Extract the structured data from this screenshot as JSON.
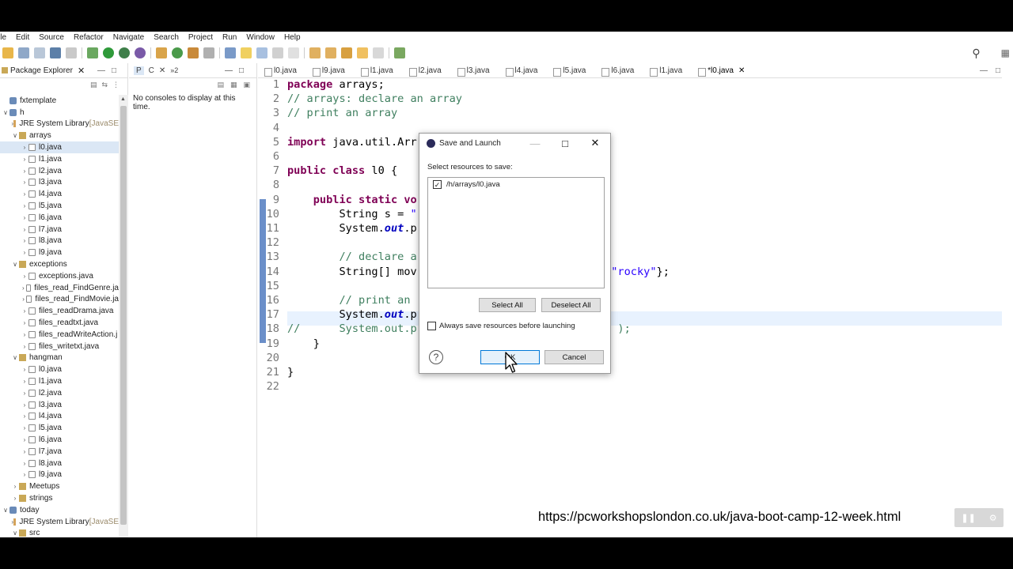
{
  "menu": [
    "ile",
    "Edit",
    "Source",
    "Refactor",
    "Navigate",
    "Search",
    "Project",
    "Run",
    "Window",
    "Help"
  ],
  "left_panel": {
    "tab_label": "Package Explorer",
    "tree": [
      {
        "label": "fxtemplate",
        "indent": 0,
        "icon": "proj",
        "arrow": ""
      },
      {
        "label": "h",
        "indent": 0,
        "icon": "proj",
        "arrow": "v"
      },
      {
        "label": "JRE System Library",
        "suffix": "[JavaSE",
        "indent": 1,
        "icon": "lib",
        "arrow": ">"
      },
      {
        "label": "arrays",
        "indent": 1,
        "icon": "pkg",
        "arrow": "v"
      },
      {
        "label": "l0.java",
        "indent": 2,
        "icon": "file",
        "arrow": ">",
        "selected": true
      },
      {
        "label": "l1.java",
        "indent": 2,
        "icon": "file",
        "arrow": ">"
      },
      {
        "label": "l2.java",
        "indent": 2,
        "icon": "file",
        "arrow": ">"
      },
      {
        "label": "l3.java",
        "indent": 2,
        "icon": "file",
        "arrow": ">"
      },
      {
        "label": "l4.java",
        "indent": 2,
        "icon": "file",
        "arrow": ">"
      },
      {
        "label": "l5.java",
        "indent": 2,
        "icon": "file",
        "arrow": ">"
      },
      {
        "label": "l6.java",
        "indent": 2,
        "icon": "file",
        "arrow": ">"
      },
      {
        "label": "l7.java",
        "indent": 2,
        "icon": "file",
        "arrow": ">"
      },
      {
        "label": "l8.java",
        "indent": 2,
        "icon": "file",
        "arrow": ">"
      },
      {
        "label": "l9.java",
        "indent": 2,
        "icon": "file",
        "arrow": ">"
      },
      {
        "label": "exceptions",
        "indent": 1,
        "icon": "pkg",
        "arrow": "v"
      },
      {
        "label": "exceptions.java",
        "indent": 2,
        "icon": "file",
        "arrow": ">"
      },
      {
        "label": "files_read_FindGenre.ja",
        "indent": 2,
        "icon": "file",
        "arrow": ">"
      },
      {
        "label": "files_read_FindMovie.ja",
        "indent": 2,
        "icon": "file",
        "arrow": ">"
      },
      {
        "label": "files_readDrama.java",
        "indent": 2,
        "icon": "file",
        "arrow": ">"
      },
      {
        "label": "files_readtxt.java",
        "indent": 2,
        "icon": "file",
        "arrow": ">"
      },
      {
        "label": "files_readWriteAction.j",
        "indent": 2,
        "icon": "file",
        "arrow": ">"
      },
      {
        "label": "files_writetxt.java",
        "indent": 2,
        "icon": "file",
        "arrow": ">"
      },
      {
        "label": "hangman",
        "indent": 1,
        "icon": "pkg",
        "arrow": "v"
      },
      {
        "label": "l0.java",
        "indent": 2,
        "icon": "file",
        "arrow": ">"
      },
      {
        "label": "l1.java",
        "indent": 2,
        "icon": "file",
        "arrow": ">"
      },
      {
        "label": "l2.java",
        "indent": 2,
        "icon": "file",
        "arrow": ">"
      },
      {
        "label": "l3.java",
        "indent": 2,
        "icon": "file",
        "arrow": ">"
      },
      {
        "label": "l4.java",
        "indent": 2,
        "icon": "file",
        "arrow": ">"
      },
      {
        "label": "l5.java",
        "indent": 2,
        "icon": "file",
        "arrow": ">"
      },
      {
        "label": "l6.java",
        "indent": 2,
        "icon": "file",
        "arrow": ">"
      },
      {
        "label": "l7.java",
        "indent": 2,
        "icon": "file",
        "arrow": ">"
      },
      {
        "label": "l8.java",
        "indent": 2,
        "icon": "file",
        "arrow": ">"
      },
      {
        "label": "l9.java",
        "indent": 2,
        "icon": "file",
        "arrow": ">"
      },
      {
        "label": "Meetups",
        "indent": 1,
        "icon": "pkg",
        "arrow": ">"
      },
      {
        "label": "strings",
        "indent": 1,
        "icon": "pkg",
        "arrow": ">"
      },
      {
        "label": "today",
        "indent": 0,
        "icon": "proj",
        "arrow": "v"
      },
      {
        "label": "JRE System Library",
        "suffix": "[JavaSE",
        "indent": 1,
        "icon": "lib",
        "arrow": ">"
      },
      {
        "label": "src",
        "indent": 1,
        "icon": "pkg",
        "arrow": "v"
      }
    ]
  },
  "console": {
    "tab_label": "C",
    "message": "No consoles to display at this time."
  },
  "editor": {
    "tabs": [
      "l0.java",
      "l9.java",
      "l1.java",
      "l2.java",
      "l3.java",
      "l4.java",
      "l5.java",
      "l6.java",
      "l1.java",
      "*l0.java"
    ],
    "lines": [
      {
        "n": "1",
        "html": "<span class='kw'>package</span> arrays;"
      },
      {
        "n": "2",
        "html": "<span class='cm'>// arrays: declare an array</span>"
      },
      {
        "n": "3",
        "html": "<span class='cm'>// print an array</span>"
      },
      {
        "n": "4",
        "html": ""
      },
      {
        "n": "5",
        "html": "<span class='kw'>import</span> java.util.Arr"
      },
      {
        "n": "6",
        "html": ""
      },
      {
        "n": "7",
        "html": "<span class='kw'>public class</span> l0 {"
      },
      {
        "n": "8",
        "html": ""
      },
      {
        "n": "9",
        "html": "    <span class='kw'>public static</span> <span class='kw'>vo</span>"
      },
      {
        "n": "10",
        "html": "        String s = <span class='st'>\"</span>"
      },
      {
        "n": "11",
        "html": "        System.<span class='it'>out</span>.p"
      },
      {
        "n": "12",
        "html": ""
      },
      {
        "n": "13",
        "html": "        <span class='cm'>// declare a</span>"
      },
      {
        "n": "14",
        "html": "        String[] mov                         <span class='st'>ace\"</span>,<span class='st'>\"rocky\"</span>};"
      },
      {
        "n": "15",
        "html": ""
      },
      {
        "n": "16",
        "html": "        <span class='cm'>// print an</span>"
      },
      {
        "n": "17",
        "html": "        System.<span class='it'>out</span>.p"
      },
      {
        "n": "18",
        "html": "<span class='cm'>//      System.out.p                          ies) );</span>"
      },
      {
        "n": "19",
        "html": "    }"
      },
      {
        "n": "20",
        "html": ""
      },
      {
        "n": "21",
        "html": "}"
      },
      {
        "n": "22",
        "html": ""
      }
    ]
  },
  "dialog": {
    "title": "Save and Launch",
    "prompt": "Select resources to save:",
    "resource": "/h/arrays/l0.java",
    "resource_checked": true,
    "select_all": "Select All",
    "deselect_all": "Deselect All",
    "always_save": "Always save resources before launching",
    "always_save_checked": false,
    "ok": "OK",
    "cancel": "Cancel"
  },
  "watermark_url": "https://pcworkshopslondon.co.uk/java-boot-camp-12-week.html"
}
